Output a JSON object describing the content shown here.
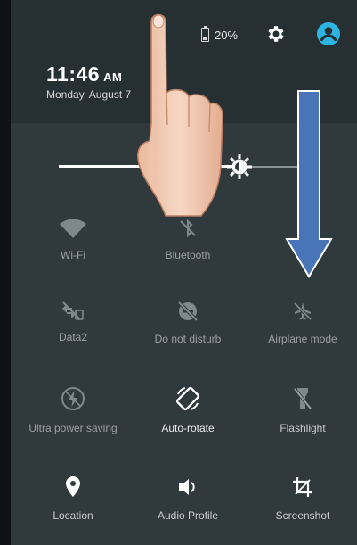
{
  "status_bar": {
    "battery_percent": "20%",
    "settings_icon": "gear-icon",
    "user_icon": "account-circle-icon"
  },
  "header": {
    "time": "11:46",
    "ampm": "AM",
    "date": "Monday, August 7"
  },
  "brightness": {
    "level": 0.75
  },
  "tiles": [
    {
      "label": "Wi-Fi",
      "icon": "wifi-icon",
      "state": "off"
    },
    {
      "label": "Bluetooth",
      "icon": "bluetooth-off-icon",
      "state": "off"
    },
    {
      "label": "Data2",
      "icon": "mobile-data-off-icon",
      "state": "off"
    },
    {
      "label": "Do not disturb",
      "icon": "do-not-disturb-icon",
      "state": "off"
    },
    {
      "label": "Airplane mode",
      "icon": "airplane-icon",
      "state": "off"
    },
    {
      "label": "Ultra power saving",
      "icon": "power-saving-icon",
      "state": "off"
    },
    {
      "label": "Auto-rotate",
      "icon": "auto-rotate-icon",
      "state": "on"
    },
    {
      "label": "Flashlight",
      "icon": "flashlight-off-icon",
      "state": "off"
    },
    {
      "label": "Location",
      "icon": "location-pin-icon",
      "state": "on"
    },
    {
      "label": "Audio Profile",
      "icon": "speaker-icon",
      "state": "on"
    },
    {
      "label": "Screenshot",
      "icon": "screenshot-crop-icon",
      "state": "on"
    }
  ],
  "overlay": {
    "gesture": "swipe-down",
    "arrow_color": "#4a74b8",
    "hand_icon": "pointing-hand-icon"
  },
  "colors": {
    "header_bg": "#263033",
    "panel_bg": "#30393c"
  }
}
